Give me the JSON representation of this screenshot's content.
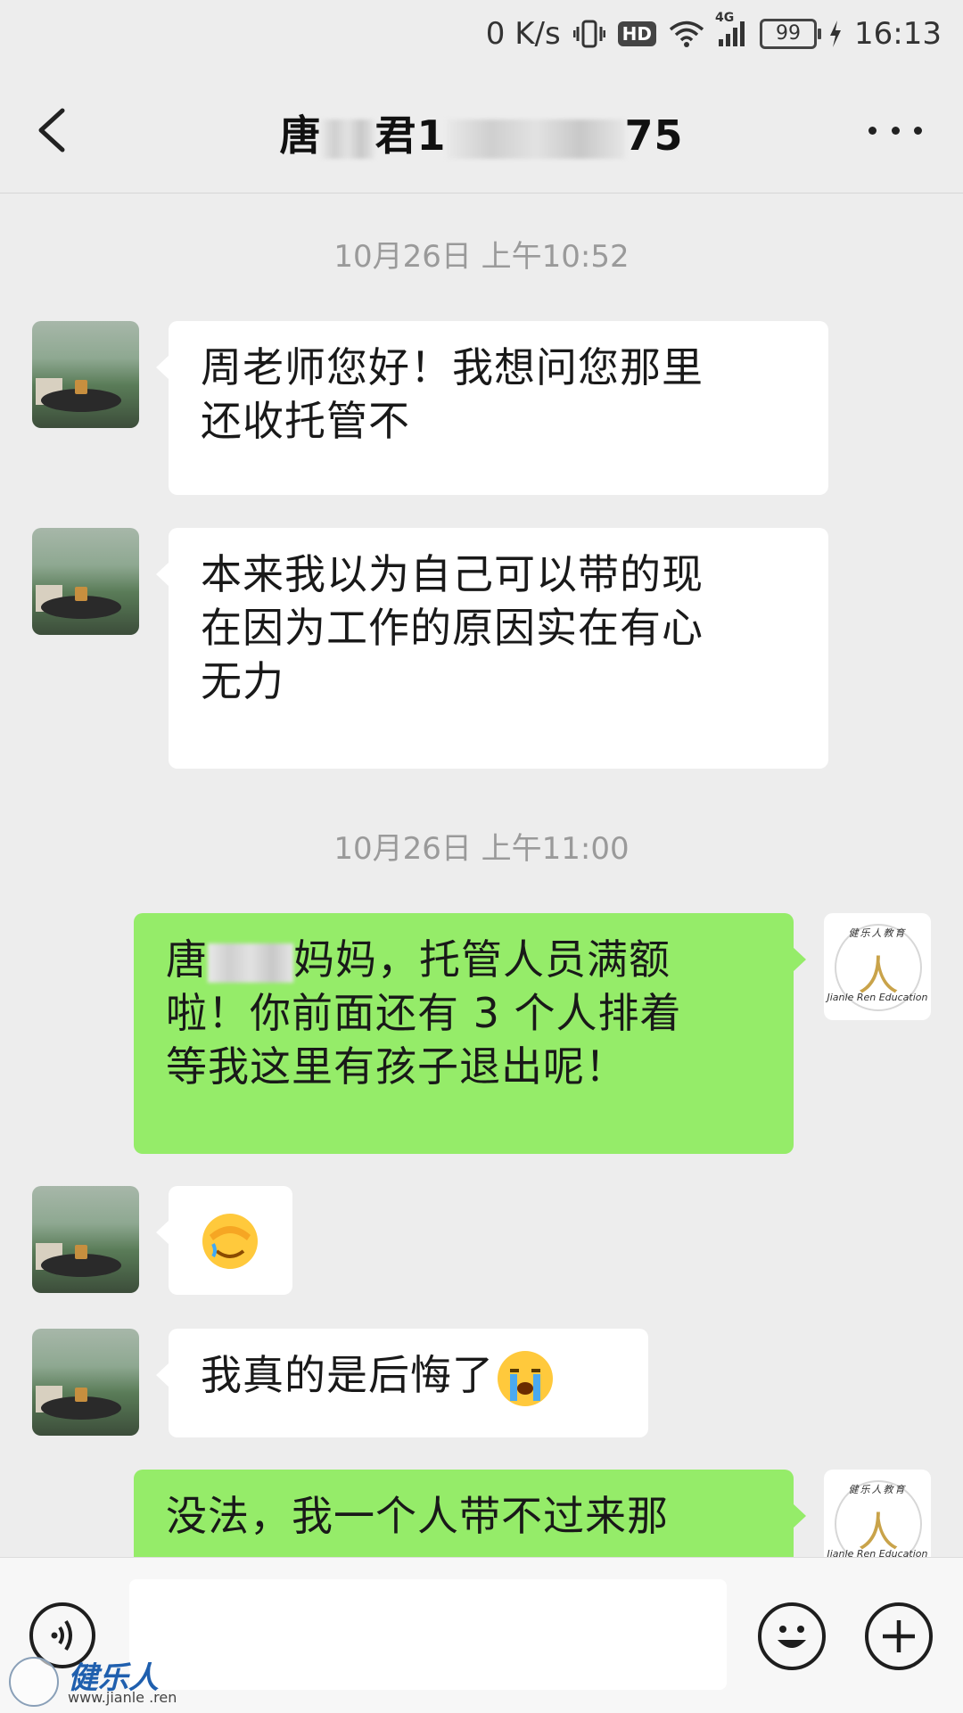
{
  "status_bar": {
    "network_speed": "0 K/s",
    "hd_label": "HD",
    "signal_label": "4G",
    "battery": "99",
    "time": "16:13"
  },
  "header": {
    "title_prefix": "唐",
    "title_middle": "君1",
    "title_suffix": "75"
  },
  "messages": {
    "ts1": "10月26日 上午10:52",
    "m1": [
      "周老师您好！我想问您那里",
      "还收托管不"
    ],
    "m2": [
      "本来我以为自己可以带的现",
      "在因为工作的原因实在有心",
      "无力"
    ],
    "ts2": "10月26日 上午11:00",
    "m3_prefix": "唐",
    "m3_lines": [
      "妈妈，托管人员满额",
      "啦！你前面还有 3 个人排着",
      "等我这里有孩子退出呢！"
    ],
    "m4_emoji": "facepalm-emoji",
    "m5_text": "我真的是后悔了",
    "m5_emoji": "crying-emoji",
    "m6_text": "没法，我一个人带不过来那"
  },
  "brand": {
    "script": "Jianle Ren Education",
    "seal_text": "健乐人教育"
  },
  "watermark": {
    "cn": "健乐人",
    "url": "www.jianle .ren"
  },
  "colors": {
    "background": "#ededed",
    "sent_bubble": "#95ec69",
    "received_bubble": "#ffffff"
  }
}
